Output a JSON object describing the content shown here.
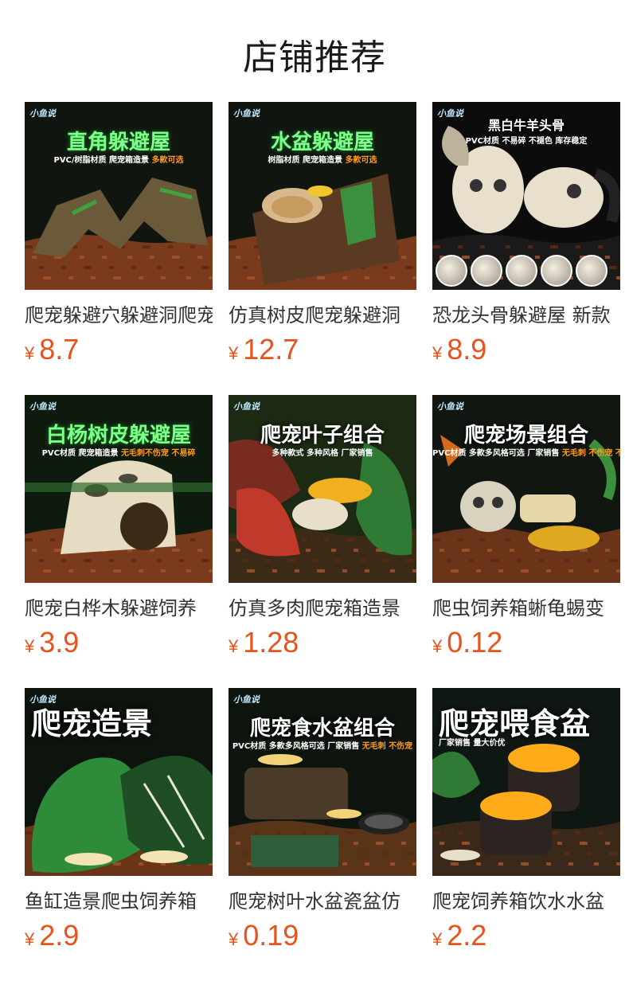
{
  "header": {
    "title": "店铺推荐"
  },
  "currency": "¥",
  "products": [
    {
      "title": "爬宠躲避穴躲避洞爬宠",
      "price": "8.7",
      "image": {
        "brand": "小鱼说",
        "headline": "直角躲避屋",
        "headline_color": "#7dff8a",
        "subline": "PVC/树脂材质  爬宠箱造景",
        "highlight": "多款可选",
        "bg": "#101510",
        "object_color": "#6b5a3a",
        "ground_color": "#7a3a1c",
        "icon": "rock-cave-icon"
      }
    },
    {
      "title": "仿真树皮爬宠躲避洞",
      "price": "12.7",
      "image": {
        "brand": "小鱼说",
        "headline": "水盆躲避屋",
        "headline_color": "#7dff8a",
        "subline": "树脂材质  爬宠箱造景",
        "highlight": "多款可选",
        "bg": "#101510",
        "object_color": "#5a3a22",
        "ground_color": "#7a3a1c",
        "icon": "log-bowl-icon"
      }
    },
    {
      "title": "恐龙头骨躲避屋 新款",
      "price": "8.9",
      "image": {
        "brand": "小鱼说",
        "headline": "黑白牛羊头骨",
        "headline_color": "#ffffff",
        "subline": "PVC材质  不易碎  不褪色  库存稳定",
        "highlight": "",
        "bg": "#0c0c0c",
        "object_color": "#e8e0cc",
        "ground_color": "#1a1a1a",
        "icon": "skull-icon"
      }
    },
    {
      "title": "爬宠白桦木躲避饲养",
      "price": "3.9",
      "image": {
        "brand": "小鱼说",
        "headline": "白杨树皮躲避屋",
        "headline_color": "#7dff8a",
        "subline": "PVC材质  爬宠箱造景",
        "highlight": "无毛刺不伤宠  不易碎",
        "bg": "#0f1a0f",
        "object_color": "#e6dcc2",
        "ground_color": "#7a3a1c",
        "icon": "birch-log-icon"
      }
    },
    {
      "title": "仿真多肉爬宠箱造景",
      "price": "1.28",
      "image": {
        "brand": "小鱼说",
        "headline": "爬宠叶子组合",
        "headline_color": "#ffffff",
        "subline": "多种款式  多种风格  厂家销售",
        "highlight": "",
        "bg": "#1c2a14",
        "object_color": "#c0392b",
        "ground_color": "#3b2a16",
        "icon": "plant-leaves-icon"
      }
    },
    {
      "title": "爬虫饲养箱蜥龟蜴变",
      "price": "0.12",
      "image": {
        "brand": "小鱼说",
        "headline": "爬宠场景组合",
        "headline_color": "#ffffff",
        "subline": "PVC材质  多款多风格可选  厂家销售",
        "highlight": "无毛刺  不伤宠  不会碎",
        "bg": "#111611",
        "object_color": "#d9d2bf",
        "ground_color": "#6a3418",
        "icon": "scene-set-icon"
      }
    },
    {
      "title": "鱼缸造景爬虫饲养箱",
      "price": "2.9",
      "image": {
        "brand": "小鱼说",
        "headline": "爬宠造景",
        "headline_color": "#ffffff",
        "subline": "",
        "highlight": "",
        "bg": "#0d130d",
        "object_color": "#2e8b3a",
        "ground_color": "#6a3418",
        "icon": "monstera-icon"
      }
    },
    {
      "title": "爬宠树叶水盆瓷盆仿",
      "price": "0.19",
      "image": {
        "brand": "小鱼说",
        "headline": "爬宠食水盆组合",
        "headline_color": "#ffffff",
        "subline": "PVC材质  多款多风格可选  厂家销售",
        "highlight": "无毛刺  不伤宠",
        "bg": "#0e140e",
        "object_color": "#2f5f3a",
        "ground_color": "#5a3418",
        "icon": "water-dish-icon"
      }
    },
    {
      "title": "爬宠饲养箱饮水水盆",
      "price": "2.2",
      "image": {
        "brand": "",
        "headline": "爬宠喂食盆",
        "headline_color": "#ffffff",
        "subline": "厂家销售  量大价优",
        "highlight": "",
        "bg": "#0f1712",
        "object_color": "#ffab1a",
        "ground_color": "#3a2818",
        "icon": "feeding-bowl-icon"
      }
    }
  ]
}
